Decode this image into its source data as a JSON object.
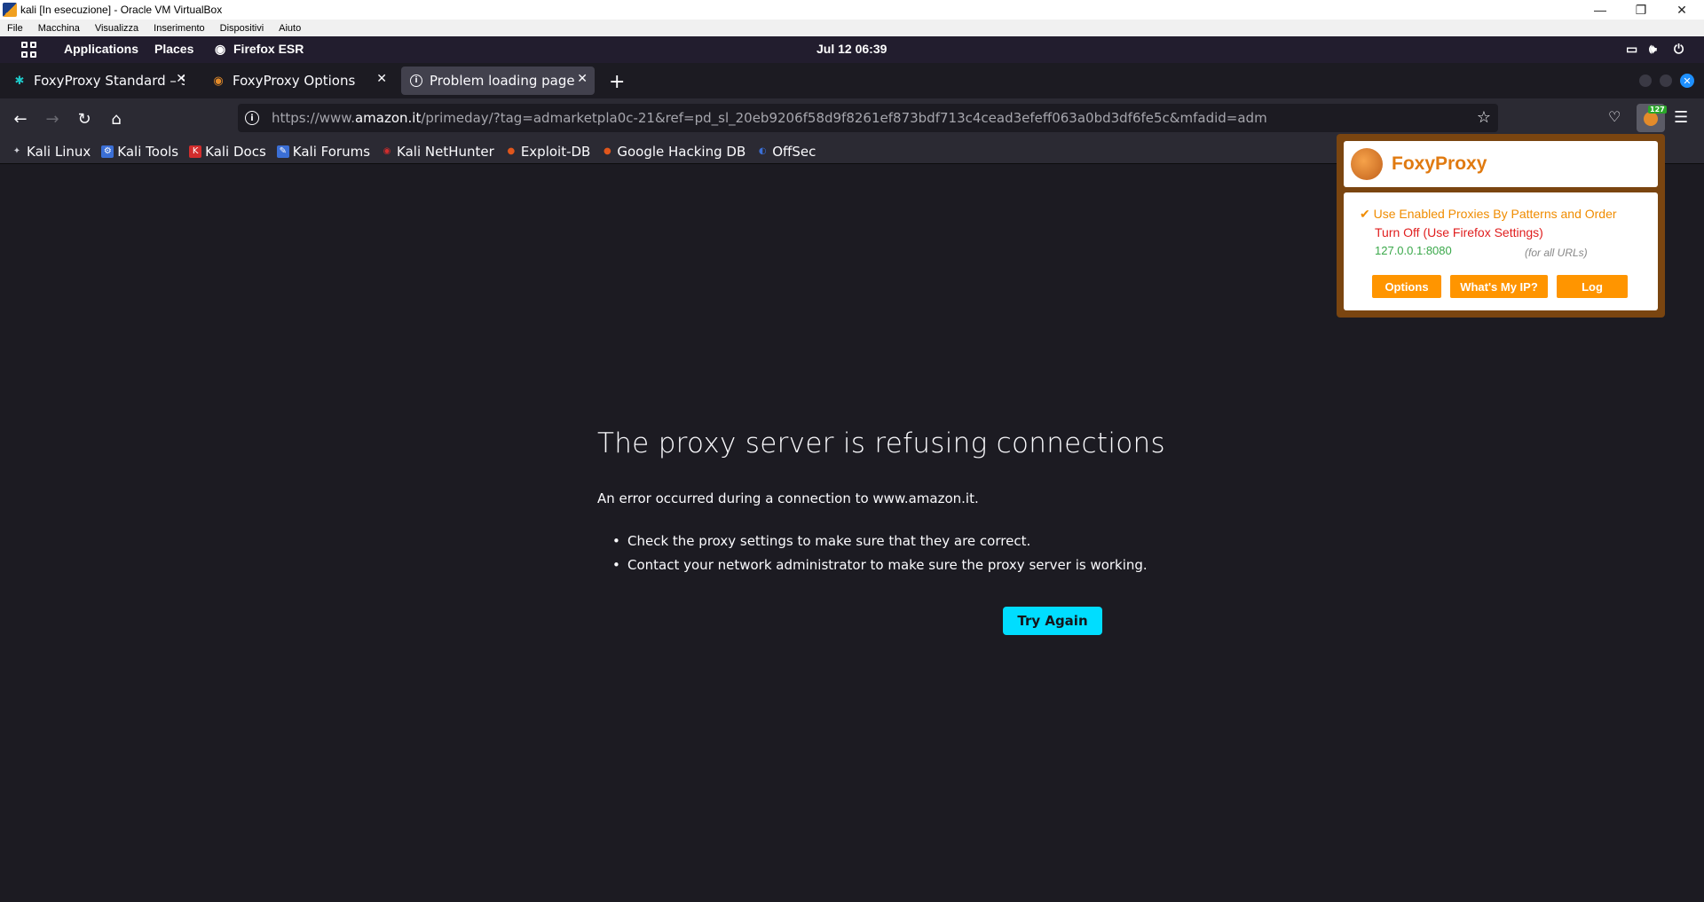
{
  "vbox": {
    "title": "kali [In esecuzione] - Oracle VM VirtualBox",
    "menu": [
      "File",
      "Macchina",
      "Visualizza",
      "Inserimento",
      "Dispositivi",
      "Aiuto"
    ]
  },
  "panel": {
    "applications": "Applications",
    "places": "Places",
    "active_app": "Firefox ESR",
    "clock": "Jul 12  06:39"
  },
  "tabs": [
    {
      "label": "FoxyProxy Standard – Sca",
      "icon": "foxyproxy-puzzle-icon"
    },
    {
      "label": "FoxyProxy Options",
      "icon": "foxyproxy-icon"
    },
    {
      "label": "Problem loading page",
      "icon": "info-icon",
      "active": true
    }
  ],
  "navbar": {
    "url_prefix": "https://www.",
    "url_domain": "amazon.it",
    "url_rest": "/primeday/?tag=admarketpla0c-21&ref=pd_sl_20eb9206f58d9f8261ef873bdf713c4cead3efeff063a0bd3df6fe5c&mfadid=adm",
    "foxy_badge": "127"
  },
  "bookmarks": [
    {
      "label": "Kali Linux",
      "color": "#1c1b22",
      "glyph": "🐉"
    },
    {
      "label": "Kali Tools",
      "color": "#3b6fd6",
      "glyph": "⚙"
    },
    {
      "label": "Kali Docs",
      "color": "#d22d2d",
      "glyph": "K"
    },
    {
      "label": "Kali Forums",
      "color": "#3b6fd6",
      "glyph": "✎"
    },
    {
      "label": "Kali NetHunter",
      "color": "#d22d2d",
      "glyph": "◉"
    },
    {
      "label": "Exploit-DB",
      "color": "#e0561c",
      "glyph": "●"
    },
    {
      "label": "Google Hacking DB",
      "color": "#e0561c",
      "glyph": "●"
    },
    {
      "label": "OffSec",
      "color": "#3b6fd6",
      "glyph": "◐"
    }
  ],
  "error": {
    "title": "The proxy server is refusing connections",
    "description": "An error occurred during a connection to www.amazon.it.",
    "items": [
      "Check the proxy settings to make sure that they are correct.",
      "Contact your network administrator to make sure the proxy server is working."
    ],
    "button": "Try Again"
  },
  "foxyproxy": {
    "name": "FoxyProxy",
    "check": "✔",
    "option_patterns": "Use Enabled Proxies By Patterns and Order",
    "option_off": "Turn Off (Use Firefox Settings)",
    "proxy": "127.0.0.1:8080",
    "proxy_hint": "(for all URLs)",
    "buttons": [
      "Options",
      "What's My IP?",
      "Log"
    ]
  }
}
